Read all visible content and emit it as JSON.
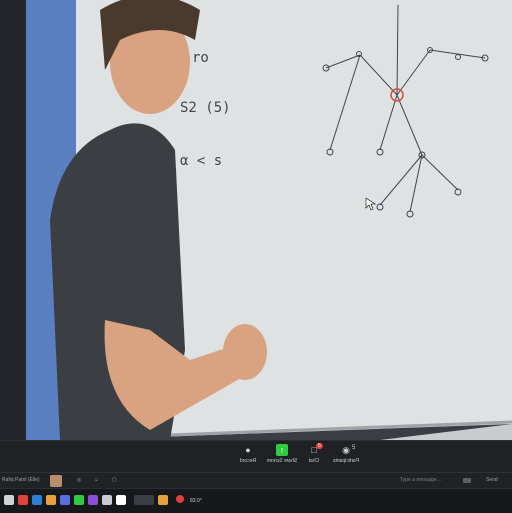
{
  "meeting_controls": [
    {
      "label": "Record",
      "icon": "record-icon",
      "color": "#c9ccd2"
    },
    {
      "label": "Share Screen",
      "icon": "share-screen-icon",
      "color": "#2ecc40"
    },
    {
      "label": "Chat",
      "icon": "chat-icon",
      "color": "#c9ccd2",
      "badge": "5"
    },
    {
      "label": "Participants",
      "icon": "participants-icon",
      "color": "#c9ccd2",
      "count": "5"
    }
  ],
  "chat": {
    "placeholder": "Type a message...",
    "send_label": "Send"
  },
  "taskbar": {
    "time": "83.0°",
    "user_text": "Rafiq Patel (Elle)"
  },
  "whiteboard": {
    "labels": [
      "ro",
      "S2 (5)",
      "α < s"
    ]
  },
  "colors": {
    "accent": "#2ecc40",
    "badge": "#e0413a",
    "node_red": "#d94a3a"
  }
}
